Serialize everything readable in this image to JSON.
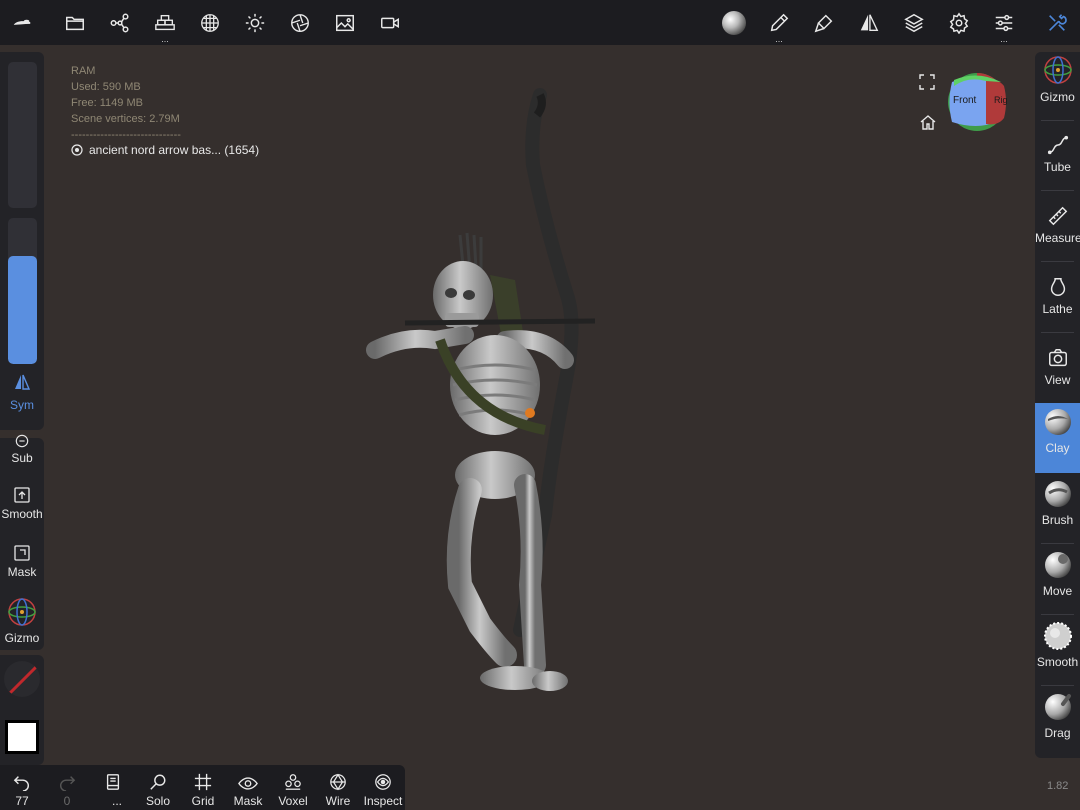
{
  "top_toolbar": {
    "items": [
      {
        "name": "menu-icon"
      },
      {
        "name": "folder-icon"
      },
      {
        "name": "scene-graph-icon"
      },
      {
        "name": "primitives-icon"
      },
      {
        "name": "material-sphere-icon"
      },
      {
        "name": "light-icon"
      },
      {
        "name": "shading-icon"
      },
      {
        "name": "background-image-icon"
      },
      {
        "name": "camera-record-icon"
      }
    ],
    "right_items": [
      {
        "name": "material-preview-icon"
      },
      {
        "name": "paint-brush-icon"
      },
      {
        "name": "stroke-icon"
      },
      {
        "name": "symmetry-icon"
      },
      {
        "name": "layers-icon"
      },
      {
        "name": "settings-icon"
      },
      {
        "name": "sliders-icon"
      },
      {
        "name": "tools-icon"
      }
    ],
    "dots": "..."
  },
  "info": {
    "ram": "RAM",
    "used": "Used: 590 MB",
    "free": "Free: 1149 MB",
    "scene_vertices": "Scene vertices: 2.79M",
    "separator": "------------------------------",
    "mesh_name": "ancient nord arrow bas... (1654)"
  },
  "view_cube": {
    "front": "Front",
    "right": "Rig"
  },
  "left_panel": {
    "sym_label": "Sym",
    "brush_intensity_fraction": 0.74,
    "tools": [
      {
        "label": "Sub"
      },
      {
        "label": "Smooth"
      },
      {
        "label": "Mask"
      },
      {
        "label": "Gizmo"
      }
    ]
  },
  "right_panel": {
    "tools": [
      {
        "label": "Gizmo",
        "icon": "gizmo-icon"
      },
      {
        "label": "Tube",
        "icon": "tube-icon"
      },
      {
        "label": "Measure",
        "icon": "ruler-icon"
      },
      {
        "label": "Lathe",
        "icon": "lathe-icon"
      },
      {
        "label": "View",
        "icon": "camera-icon"
      },
      {
        "label": "Clay",
        "icon": "clay-brush-icon",
        "active": true
      },
      {
        "label": "Brush",
        "icon": "brush-sphere-icon"
      },
      {
        "label": "Move",
        "icon": "move-sphere-icon"
      },
      {
        "label": "Smooth",
        "icon": "smooth-sphere-icon"
      },
      {
        "label": "Drag",
        "icon": "drag-sphere-icon"
      }
    ]
  },
  "bottom_bar": {
    "undo_count": "77",
    "redo_count": "0",
    "more": "...",
    "items": [
      {
        "label": "Solo"
      },
      {
        "label": "Grid"
      },
      {
        "label": "Mask"
      },
      {
        "label": "Voxel"
      },
      {
        "label": "Wire"
      },
      {
        "label": "Inspect"
      }
    ]
  },
  "version": "1.82",
  "colors": {
    "accent": "#4c86d8",
    "background": "#352f2d",
    "panel": "#232327",
    "toolbar": "#1c1c20"
  }
}
